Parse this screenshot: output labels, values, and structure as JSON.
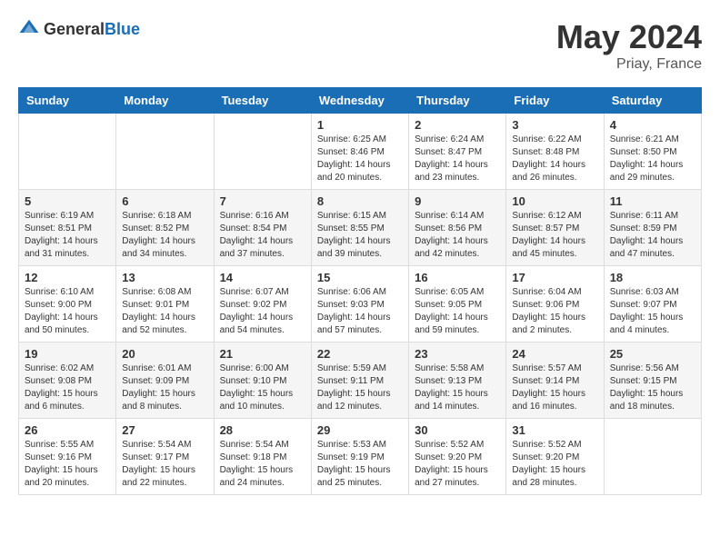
{
  "header": {
    "logo_general": "General",
    "logo_blue": "Blue",
    "month_year": "May 2024",
    "location": "Priay, France"
  },
  "weekdays": [
    "Sunday",
    "Monday",
    "Tuesday",
    "Wednesday",
    "Thursday",
    "Friday",
    "Saturday"
  ],
  "weeks": [
    [
      {
        "day": "",
        "info": ""
      },
      {
        "day": "",
        "info": ""
      },
      {
        "day": "",
        "info": ""
      },
      {
        "day": "1",
        "info": "Sunrise: 6:25 AM\nSunset: 8:46 PM\nDaylight: 14 hours\nand 20 minutes."
      },
      {
        "day": "2",
        "info": "Sunrise: 6:24 AM\nSunset: 8:47 PM\nDaylight: 14 hours\nand 23 minutes."
      },
      {
        "day": "3",
        "info": "Sunrise: 6:22 AM\nSunset: 8:48 PM\nDaylight: 14 hours\nand 26 minutes."
      },
      {
        "day": "4",
        "info": "Sunrise: 6:21 AM\nSunset: 8:50 PM\nDaylight: 14 hours\nand 29 minutes."
      }
    ],
    [
      {
        "day": "5",
        "info": "Sunrise: 6:19 AM\nSunset: 8:51 PM\nDaylight: 14 hours\nand 31 minutes."
      },
      {
        "day": "6",
        "info": "Sunrise: 6:18 AM\nSunset: 8:52 PM\nDaylight: 14 hours\nand 34 minutes."
      },
      {
        "day": "7",
        "info": "Sunrise: 6:16 AM\nSunset: 8:54 PM\nDaylight: 14 hours\nand 37 minutes."
      },
      {
        "day": "8",
        "info": "Sunrise: 6:15 AM\nSunset: 8:55 PM\nDaylight: 14 hours\nand 39 minutes."
      },
      {
        "day": "9",
        "info": "Sunrise: 6:14 AM\nSunset: 8:56 PM\nDaylight: 14 hours\nand 42 minutes."
      },
      {
        "day": "10",
        "info": "Sunrise: 6:12 AM\nSunset: 8:57 PM\nDaylight: 14 hours\nand 45 minutes."
      },
      {
        "day": "11",
        "info": "Sunrise: 6:11 AM\nSunset: 8:59 PM\nDaylight: 14 hours\nand 47 minutes."
      }
    ],
    [
      {
        "day": "12",
        "info": "Sunrise: 6:10 AM\nSunset: 9:00 PM\nDaylight: 14 hours\nand 50 minutes."
      },
      {
        "day": "13",
        "info": "Sunrise: 6:08 AM\nSunset: 9:01 PM\nDaylight: 14 hours\nand 52 minutes."
      },
      {
        "day": "14",
        "info": "Sunrise: 6:07 AM\nSunset: 9:02 PM\nDaylight: 14 hours\nand 54 minutes."
      },
      {
        "day": "15",
        "info": "Sunrise: 6:06 AM\nSunset: 9:03 PM\nDaylight: 14 hours\nand 57 minutes."
      },
      {
        "day": "16",
        "info": "Sunrise: 6:05 AM\nSunset: 9:05 PM\nDaylight: 14 hours\nand 59 minutes."
      },
      {
        "day": "17",
        "info": "Sunrise: 6:04 AM\nSunset: 9:06 PM\nDaylight: 15 hours\nand 2 minutes."
      },
      {
        "day": "18",
        "info": "Sunrise: 6:03 AM\nSunset: 9:07 PM\nDaylight: 15 hours\nand 4 minutes."
      }
    ],
    [
      {
        "day": "19",
        "info": "Sunrise: 6:02 AM\nSunset: 9:08 PM\nDaylight: 15 hours\nand 6 minutes."
      },
      {
        "day": "20",
        "info": "Sunrise: 6:01 AM\nSunset: 9:09 PM\nDaylight: 15 hours\nand 8 minutes."
      },
      {
        "day": "21",
        "info": "Sunrise: 6:00 AM\nSunset: 9:10 PM\nDaylight: 15 hours\nand 10 minutes."
      },
      {
        "day": "22",
        "info": "Sunrise: 5:59 AM\nSunset: 9:11 PM\nDaylight: 15 hours\nand 12 minutes."
      },
      {
        "day": "23",
        "info": "Sunrise: 5:58 AM\nSunset: 9:13 PM\nDaylight: 15 hours\nand 14 minutes."
      },
      {
        "day": "24",
        "info": "Sunrise: 5:57 AM\nSunset: 9:14 PM\nDaylight: 15 hours\nand 16 minutes."
      },
      {
        "day": "25",
        "info": "Sunrise: 5:56 AM\nSunset: 9:15 PM\nDaylight: 15 hours\nand 18 minutes."
      }
    ],
    [
      {
        "day": "26",
        "info": "Sunrise: 5:55 AM\nSunset: 9:16 PM\nDaylight: 15 hours\nand 20 minutes."
      },
      {
        "day": "27",
        "info": "Sunrise: 5:54 AM\nSunset: 9:17 PM\nDaylight: 15 hours\nand 22 minutes."
      },
      {
        "day": "28",
        "info": "Sunrise: 5:54 AM\nSunset: 9:18 PM\nDaylight: 15 hours\nand 24 minutes."
      },
      {
        "day": "29",
        "info": "Sunrise: 5:53 AM\nSunset: 9:19 PM\nDaylight: 15 hours\nand 25 minutes."
      },
      {
        "day": "30",
        "info": "Sunrise: 5:52 AM\nSunset: 9:20 PM\nDaylight: 15 hours\nand 27 minutes."
      },
      {
        "day": "31",
        "info": "Sunrise: 5:52 AM\nSunset: 9:20 PM\nDaylight: 15 hours\nand 28 minutes."
      },
      {
        "day": "",
        "info": ""
      }
    ]
  ]
}
